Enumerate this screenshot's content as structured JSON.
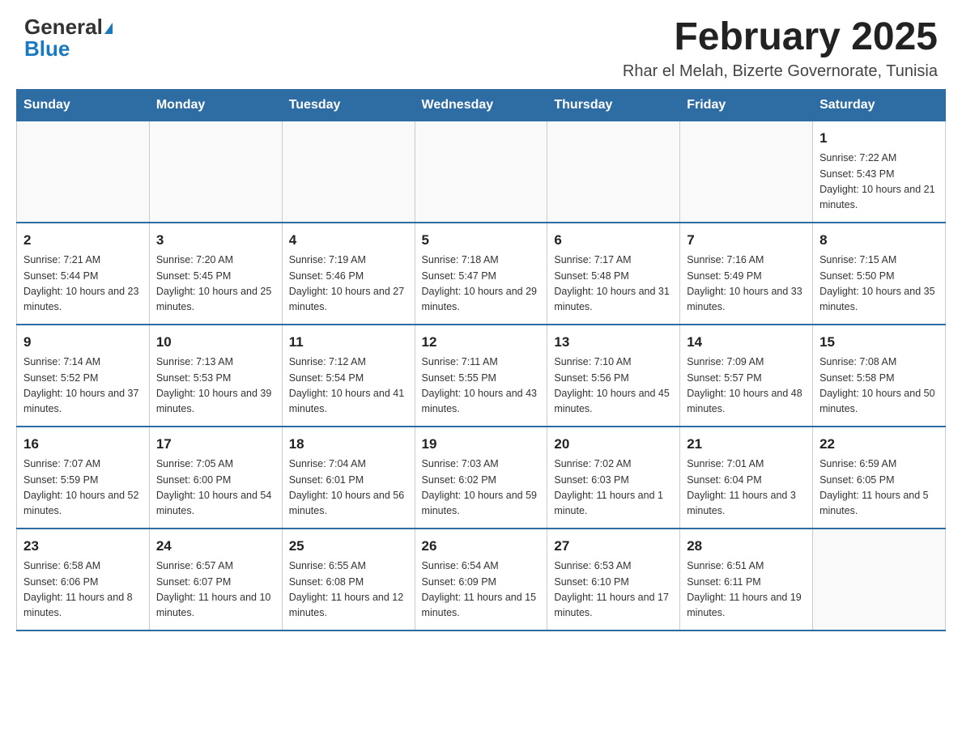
{
  "header": {
    "logo_general": "General",
    "logo_blue": "Blue",
    "title": "February 2025",
    "subtitle": "Rhar el Melah, Bizerte Governorate, Tunisia"
  },
  "weekdays": [
    "Sunday",
    "Monday",
    "Tuesday",
    "Wednesday",
    "Thursday",
    "Friday",
    "Saturday"
  ],
  "weeks": [
    [
      {
        "day": "",
        "info": ""
      },
      {
        "day": "",
        "info": ""
      },
      {
        "day": "",
        "info": ""
      },
      {
        "day": "",
        "info": ""
      },
      {
        "day": "",
        "info": ""
      },
      {
        "day": "",
        "info": ""
      },
      {
        "day": "1",
        "info": "Sunrise: 7:22 AM\nSunset: 5:43 PM\nDaylight: 10 hours and 21 minutes."
      }
    ],
    [
      {
        "day": "2",
        "info": "Sunrise: 7:21 AM\nSunset: 5:44 PM\nDaylight: 10 hours and 23 minutes."
      },
      {
        "day": "3",
        "info": "Sunrise: 7:20 AM\nSunset: 5:45 PM\nDaylight: 10 hours and 25 minutes."
      },
      {
        "day": "4",
        "info": "Sunrise: 7:19 AM\nSunset: 5:46 PM\nDaylight: 10 hours and 27 minutes."
      },
      {
        "day": "5",
        "info": "Sunrise: 7:18 AM\nSunset: 5:47 PM\nDaylight: 10 hours and 29 minutes."
      },
      {
        "day": "6",
        "info": "Sunrise: 7:17 AM\nSunset: 5:48 PM\nDaylight: 10 hours and 31 minutes."
      },
      {
        "day": "7",
        "info": "Sunrise: 7:16 AM\nSunset: 5:49 PM\nDaylight: 10 hours and 33 minutes."
      },
      {
        "day": "8",
        "info": "Sunrise: 7:15 AM\nSunset: 5:50 PM\nDaylight: 10 hours and 35 minutes."
      }
    ],
    [
      {
        "day": "9",
        "info": "Sunrise: 7:14 AM\nSunset: 5:52 PM\nDaylight: 10 hours and 37 minutes."
      },
      {
        "day": "10",
        "info": "Sunrise: 7:13 AM\nSunset: 5:53 PM\nDaylight: 10 hours and 39 minutes."
      },
      {
        "day": "11",
        "info": "Sunrise: 7:12 AM\nSunset: 5:54 PM\nDaylight: 10 hours and 41 minutes."
      },
      {
        "day": "12",
        "info": "Sunrise: 7:11 AM\nSunset: 5:55 PM\nDaylight: 10 hours and 43 minutes."
      },
      {
        "day": "13",
        "info": "Sunrise: 7:10 AM\nSunset: 5:56 PM\nDaylight: 10 hours and 45 minutes."
      },
      {
        "day": "14",
        "info": "Sunrise: 7:09 AM\nSunset: 5:57 PM\nDaylight: 10 hours and 48 minutes."
      },
      {
        "day": "15",
        "info": "Sunrise: 7:08 AM\nSunset: 5:58 PM\nDaylight: 10 hours and 50 minutes."
      }
    ],
    [
      {
        "day": "16",
        "info": "Sunrise: 7:07 AM\nSunset: 5:59 PM\nDaylight: 10 hours and 52 minutes."
      },
      {
        "day": "17",
        "info": "Sunrise: 7:05 AM\nSunset: 6:00 PM\nDaylight: 10 hours and 54 minutes."
      },
      {
        "day": "18",
        "info": "Sunrise: 7:04 AM\nSunset: 6:01 PM\nDaylight: 10 hours and 56 minutes."
      },
      {
        "day": "19",
        "info": "Sunrise: 7:03 AM\nSunset: 6:02 PM\nDaylight: 10 hours and 59 minutes."
      },
      {
        "day": "20",
        "info": "Sunrise: 7:02 AM\nSunset: 6:03 PM\nDaylight: 11 hours and 1 minute."
      },
      {
        "day": "21",
        "info": "Sunrise: 7:01 AM\nSunset: 6:04 PM\nDaylight: 11 hours and 3 minutes."
      },
      {
        "day": "22",
        "info": "Sunrise: 6:59 AM\nSunset: 6:05 PM\nDaylight: 11 hours and 5 minutes."
      }
    ],
    [
      {
        "day": "23",
        "info": "Sunrise: 6:58 AM\nSunset: 6:06 PM\nDaylight: 11 hours and 8 minutes."
      },
      {
        "day": "24",
        "info": "Sunrise: 6:57 AM\nSunset: 6:07 PM\nDaylight: 11 hours and 10 minutes."
      },
      {
        "day": "25",
        "info": "Sunrise: 6:55 AM\nSunset: 6:08 PM\nDaylight: 11 hours and 12 minutes."
      },
      {
        "day": "26",
        "info": "Sunrise: 6:54 AM\nSunset: 6:09 PM\nDaylight: 11 hours and 15 minutes."
      },
      {
        "day": "27",
        "info": "Sunrise: 6:53 AM\nSunset: 6:10 PM\nDaylight: 11 hours and 17 minutes."
      },
      {
        "day": "28",
        "info": "Sunrise: 6:51 AM\nSunset: 6:11 PM\nDaylight: 11 hours and 19 minutes."
      },
      {
        "day": "",
        "info": ""
      }
    ]
  ]
}
